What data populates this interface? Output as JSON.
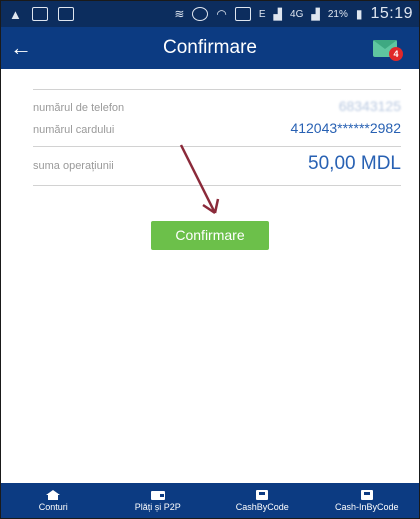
{
  "status_bar": {
    "network": "E",
    "signal": "4G",
    "battery": "21%",
    "time": "15:19"
  },
  "header": {
    "title": "Confirmare",
    "mail_badge": "4"
  },
  "details": {
    "phone_label": "numărul de telefon",
    "phone_value": "68343125",
    "card_label": "numărul cardului",
    "card_value": "412043******2982",
    "amount_label": "suma operațiunii",
    "amount_value": "50,00 MDL"
  },
  "action": {
    "confirm_label": "Confirmare"
  },
  "colors": {
    "header_bg": "#0c3b82",
    "value_blue": "#2861b3",
    "confirm_green": "#6cc04a",
    "arrow": "#8b2a3a"
  },
  "bottom_nav": [
    {
      "label": "Conturi",
      "icon": "home-icon"
    },
    {
      "label": "Plăți și P2P",
      "icon": "wallet-icon"
    },
    {
      "label": "CashByCode",
      "icon": "atm-icon"
    },
    {
      "label": "Cash-InByCode",
      "icon": "atm-in-icon"
    }
  ]
}
